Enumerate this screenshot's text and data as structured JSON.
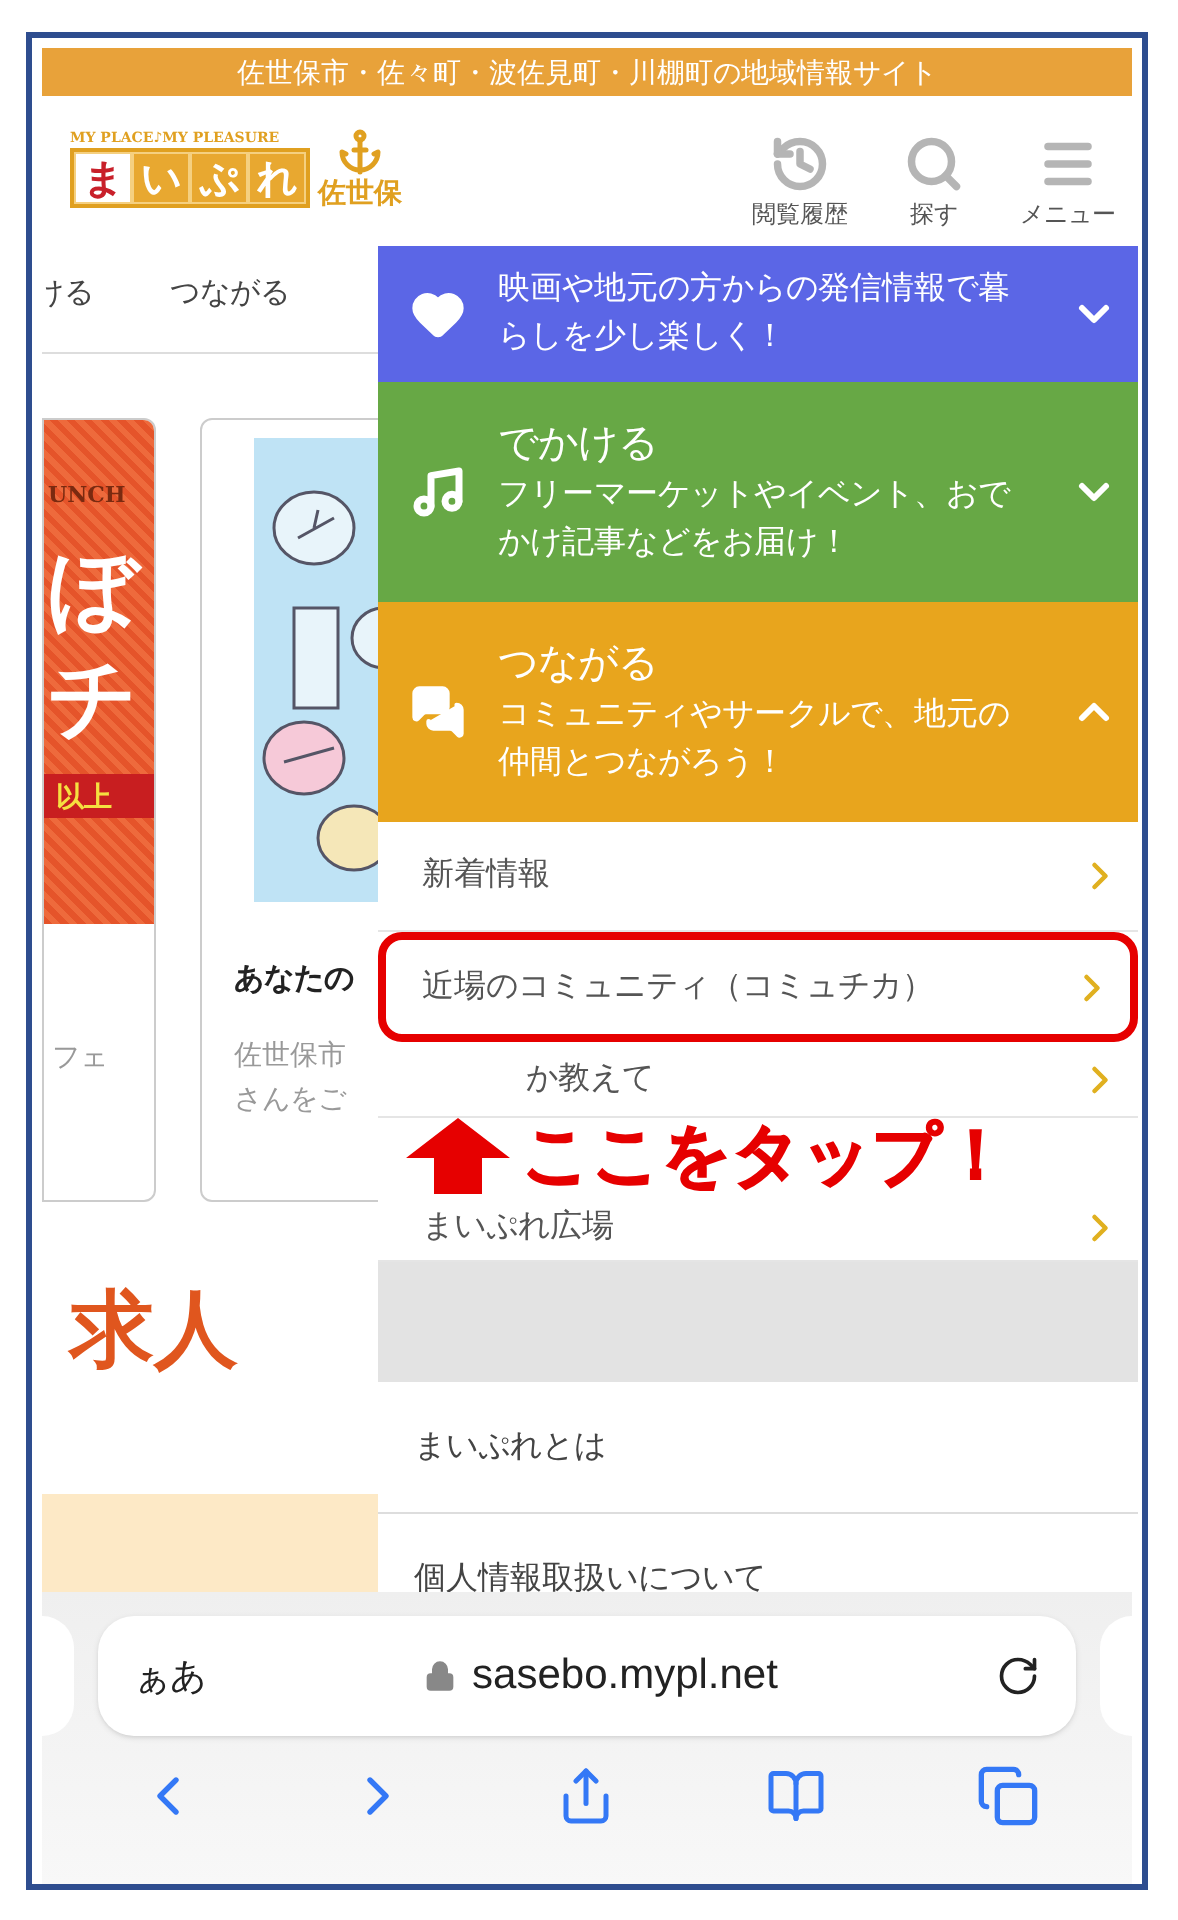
{
  "site_banner": "佐世保市・佐々町・波佐見町・川棚町の地域情報サイト",
  "logo": {
    "tagline": "MY PLACE♪MY PLEASURE",
    "letters": [
      "ま",
      "い",
      "ぷ",
      "れ"
    ],
    "city": "佐世保"
  },
  "header_actions": [
    {
      "kind": "history",
      "label": "閲覧履歴"
    },
    {
      "kind": "search",
      "label": "探す"
    },
    {
      "kind": "menu",
      "label": "メニュー"
    }
  ],
  "category_tabs": [
    {
      "label": "ける"
    },
    {
      "label": "つながる"
    }
  ],
  "lunch_banner": {
    "top": "UNCH",
    "big": [
      "ぼ",
      "チ"
    ],
    "band": "以上",
    "caption": "フェ"
  },
  "article_card": {
    "title": "あなたの",
    "lines": [
      "佐世保市",
      "さんをご"
    ]
  },
  "section_heading": "求人",
  "menu": {
    "sections": [
      {
        "kind": "heart",
        "color": "#5b66e6",
        "description": "映画や地元の方からの発信情報で暮らしを少し楽しく！",
        "expanded": false
      },
      {
        "kind": "music",
        "color": "#67a845",
        "title": "でかける",
        "description": "フリーマーケットやイベント、おでかけ記事などをお届け！",
        "expanded": false
      },
      {
        "kind": "chat",
        "color": "#e8a51d",
        "title": "つながる",
        "description": "コミュニティやサークルで、地元の仲間とつながろう！",
        "expanded": true
      }
    ],
    "links": [
      {
        "label": "新着情報",
        "highlighted": false
      },
      {
        "label": "近場のコミュニティ（コミュチカ）",
        "highlighted": true
      },
      {
        "label": "か教えて",
        "highlighted": false
      },
      {
        "label": "まいぷれ広場",
        "highlighted": false
      }
    ],
    "footer_links": [
      "まいぷれとは",
      "個人情報取扱いについて"
    ]
  },
  "annotation": {
    "text": "ここをタップ！"
  },
  "browser": {
    "text_size": "ぁあ",
    "url": "sasebo.mypl.net"
  }
}
